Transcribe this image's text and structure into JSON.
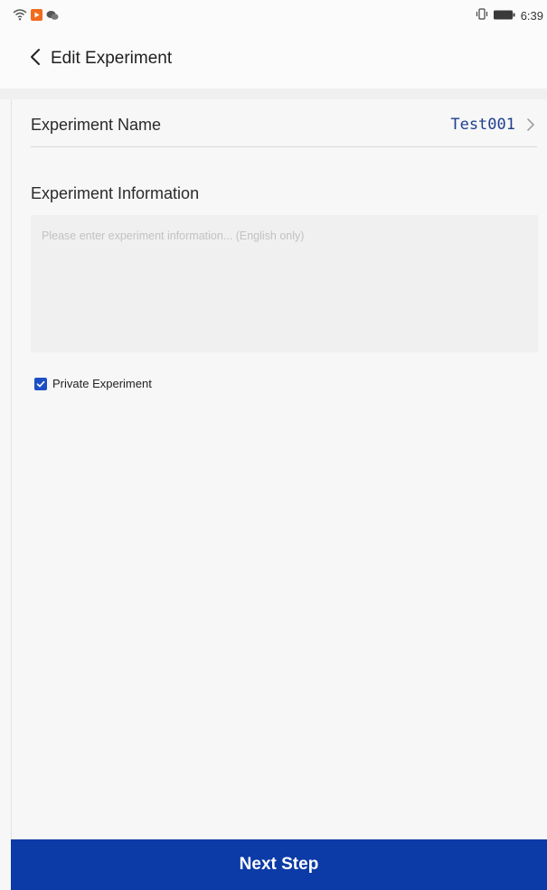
{
  "status_bar": {
    "time": "6:39",
    "icons": [
      "wifi-icon",
      "notification-app-icon",
      "wechat-icon",
      "vibrate-icon",
      "battery-icon"
    ],
    "notification_app_color": "#f26b1d"
  },
  "header": {
    "title": "Edit Experiment",
    "back_icon": "chevron-left-icon"
  },
  "experiment_name": {
    "label": "Experiment Name",
    "value": "Test001",
    "value_color": "#1d3f8c"
  },
  "experiment_information": {
    "label": "Experiment Information",
    "value": "",
    "placeholder": "Please enter experiment information... (English only)"
  },
  "private_experiment": {
    "label": "Private Experiment",
    "checked": true,
    "check_color": "#1d4fc4"
  },
  "footer": {
    "next_label": "Next Step",
    "button_color": "#0c3aa6"
  }
}
